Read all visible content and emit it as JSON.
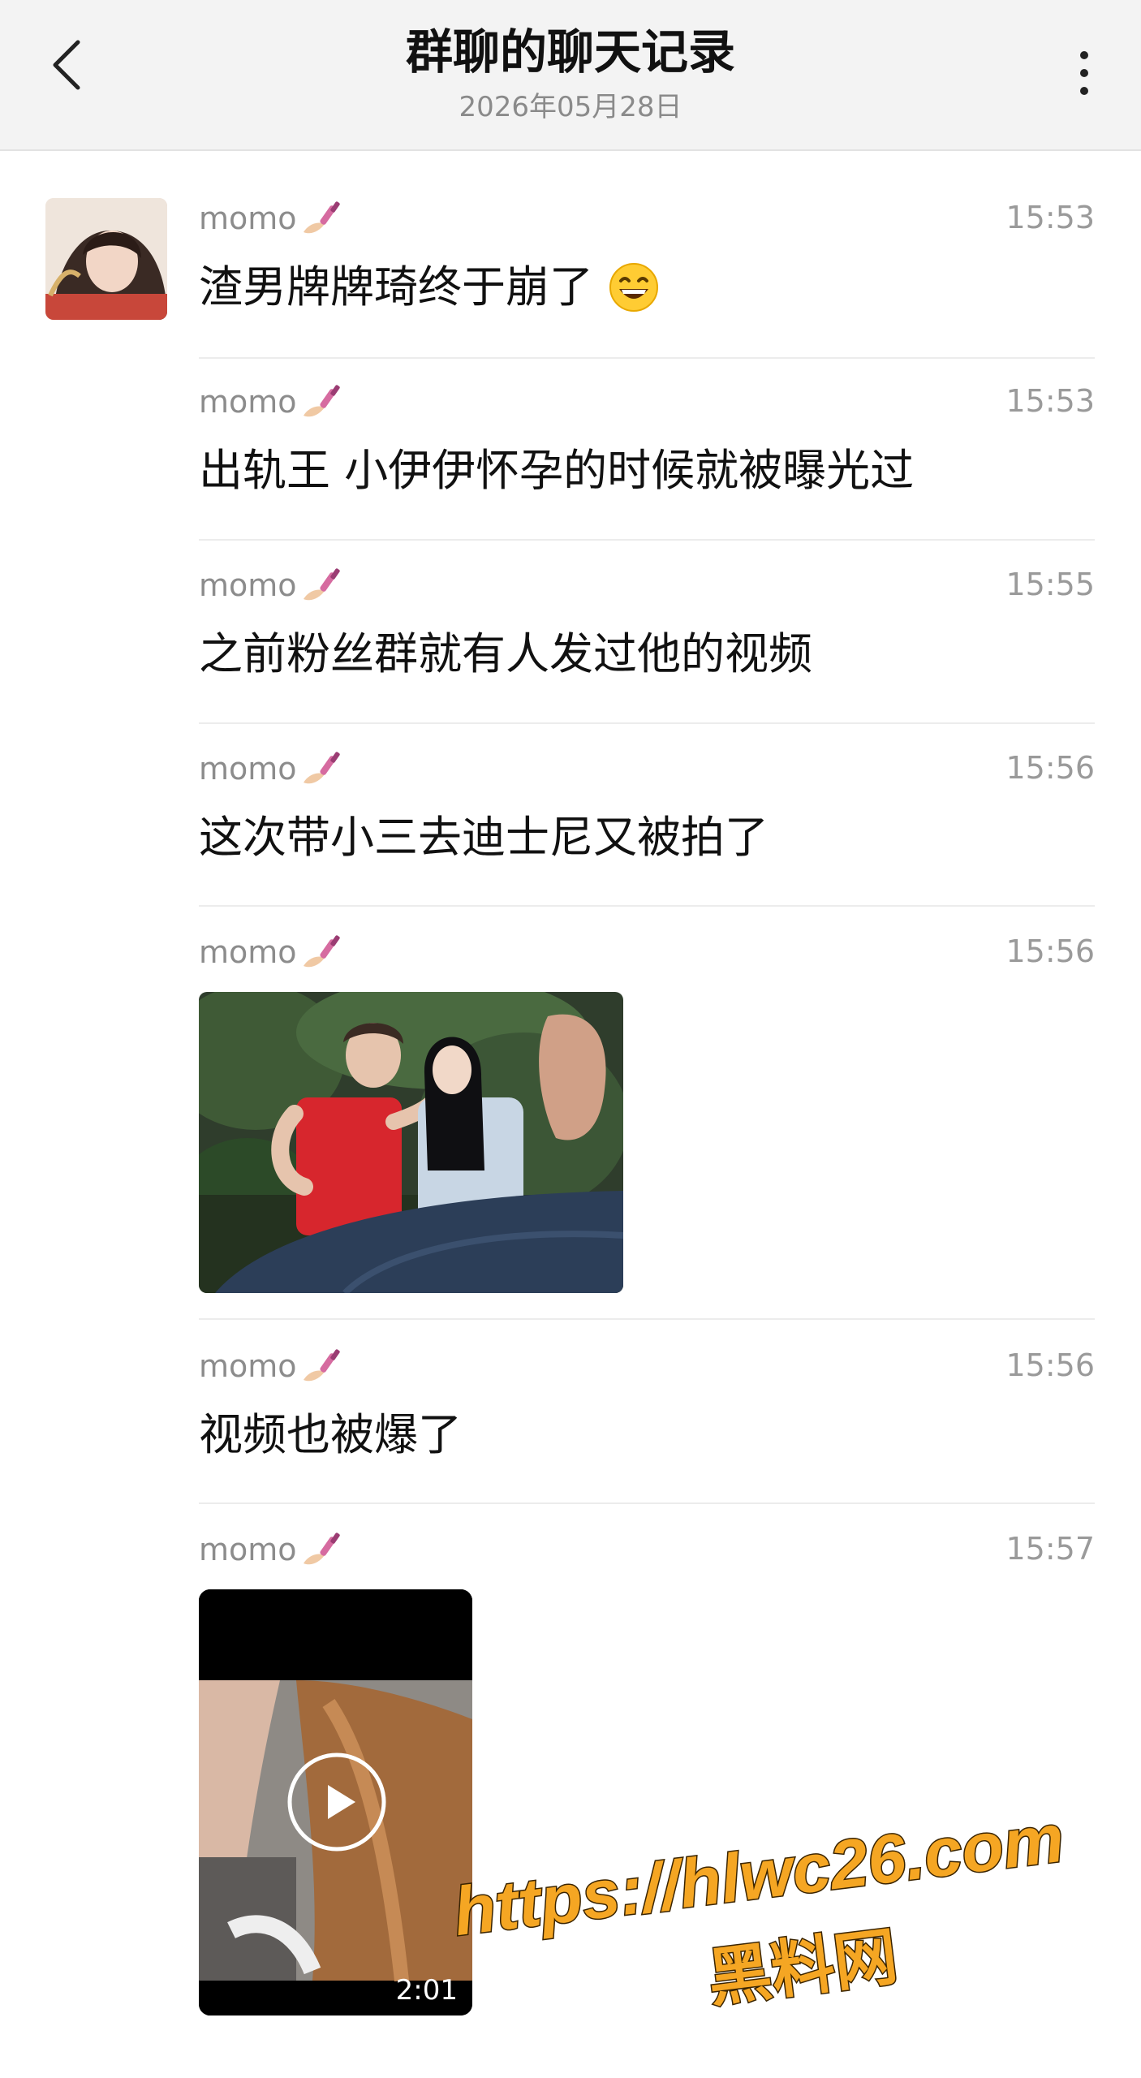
{
  "header": {
    "title": "群聊的聊天记录",
    "subtitle": "2026年05月28日",
    "back_icon": "chevron-left-icon",
    "more_icon": "more-vertical-icon"
  },
  "messages": [
    {
      "sender": "momo",
      "time": "15:53",
      "text": "渣男牌牌琦终于崩了",
      "has_emoji": true
    },
    {
      "sender": "momo",
      "time": "15:53",
      "text": "出轨王 小伊伊怀孕的时候就被曝光过"
    },
    {
      "sender": "momo",
      "time": "15:55",
      "text": "之前粉丝群就有人发过他的视频"
    },
    {
      "sender": "momo",
      "time": "15:56",
      "text": "这次带小三去迪士尼又被拍了"
    },
    {
      "sender": "momo",
      "time": "15:56",
      "type": "image"
    },
    {
      "sender": "momo",
      "time": "15:56",
      "text": "视频也被爆了"
    },
    {
      "sender": "momo",
      "time": "15:57",
      "type": "video",
      "duration": "2:01"
    }
  ],
  "watermark": {
    "url": "https://hlwc26.com",
    "name": "黑料网"
  },
  "colors": {
    "header_bg": "#f3f3f3",
    "divider": "#ececec",
    "meta_text": "#8c8c8c",
    "watermark_fill": "#f5a623"
  }
}
